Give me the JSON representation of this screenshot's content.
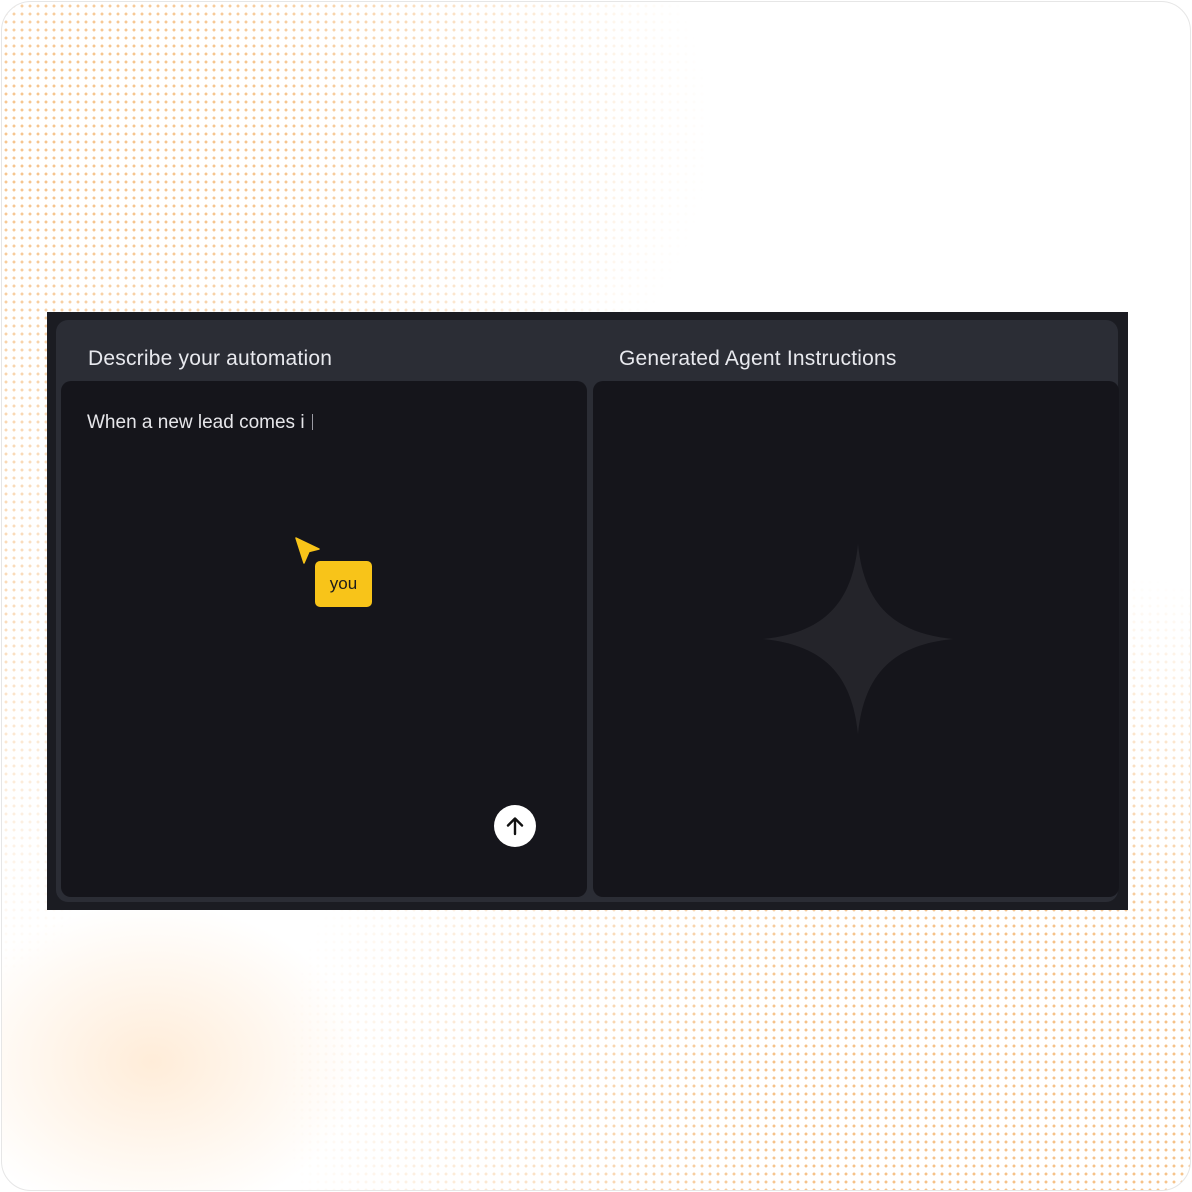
{
  "left_panel": {
    "title": "Describe your automation",
    "input_text": "When a new lead comes i",
    "submit_icon": "arrow-up-icon"
  },
  "right_panel": {
    "title": "Generated Agent Instructions",
    "placeholder_icon": "sparkle-icon"
  },
  "cursor": {
    "label": "you",
    "icon": "cursor-arrow-icon",
    "color": "#f8c419"
  },
  "colors": {
    "app_bg": "#1b1c22",
    "header_bg": "#2b2d35",
    "panel_bg": "#15151b",
    "accent": "#f8c419",
    "dot_pattern": "#f2aa5a"
  }
}
